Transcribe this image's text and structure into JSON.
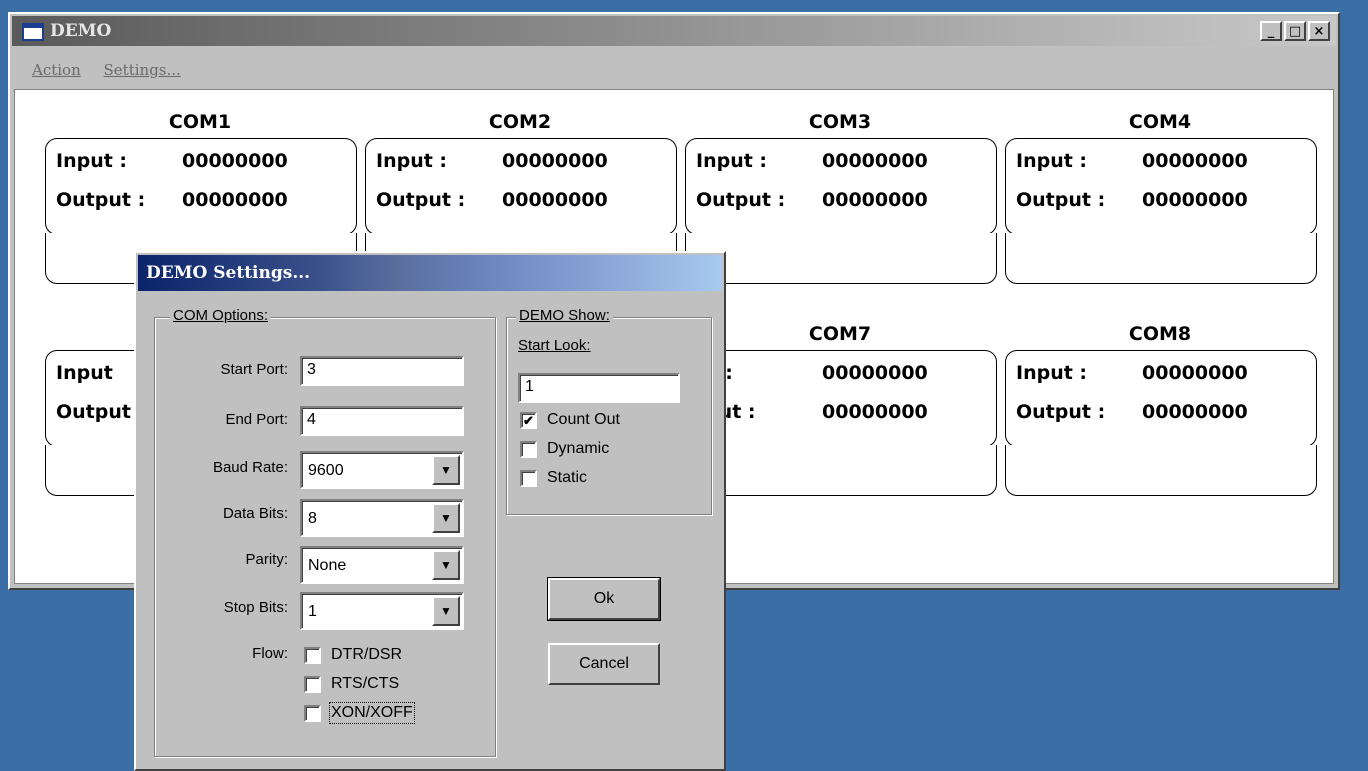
{
  "window": {
    "title": "DEMO",
    "minimize": "_",
    "maximize": "□",
    "close": "×"
  },
  "menu": {
    "action": "Action",
    "settings": "Settings..."
  },
  "com_panels": [
    {
      "title": "COM1",
      "input_label": "Input  :",
      "input_value": "00000000",
      "output_label": "Output :",
      "output_value": "00000000"
    },
    {
      "title": "COM2",
      "input_label": "Input  :",
      "input_value": "00000000",
      "output_label": "Output :",
      "output_value": "00000000"
    },
    {
      "title": "COM3",
      "input_label": "Input  :",
      "input_value": "00000000",
      "output_label": "Output :",
      "output_value": "00000000"
    },
    {
      "title": "COM4",
      "input_label": "Input  :",
      "input_value": "00000000",
      "output_label": "Output :",
      "output_value": "00000000"
    },
    {
      "title": "",
      "input_label": "Input",
      "input_value": "",
      "output_label": "Output",
      "output_value": ""
    },
    {
      "title": "",
      "input_label": "",
      "input_value": "",
      "output_label": "",
      "output_value": ""
    },
    {
      "title": "COM7",
      "input_label": "ut  :",
      "input_value": "00000000",
      "output_label": "tput :",
      "output_value": "00000000"
    },
    {
      "title": "COM8",
      "input_label": "Input  :",
      "input_value": "00000000",
      "output_label": "Output :",
      "output_value": "00000000"
    }
  ],
  "dialog": {
    "title": "DEMO Settings...",
    "com_options": {
      "label": "COM Options:",
      "start_port_label": "Start Port:",
      "start_port_value": "3",
      "end_port_label": "End Port:",
      "end_port_value": "4",
      "baud_rate_label": "Baud Rate:",
      "baud_rate_value": "9600",
      "data_bits_label": "Data Bits:",
      "data_bits_value": "8",
      "parity_label": "Parity:",
      "parity_value": "None",
      "stop_bits_label": "Stop Bits:",
      "stop_bits_value": "1",
      "flow_label": "Flow:",
      "flow_options": [
        {
          "label": "DTR/DSR",
          "checked": false
        },
        {
          "label": "RTS/CTS",
          "checked": false
        },
        {
          "label": "XON/XOFF",
          "checked": false
        }
      ]
    },
    "demo_show": {
      "label": "DEMO Show:",
      "start_look_label": "Start Look:",
      "start_look_value": "1",
      "options": [
        {
          "label": "Count Out",
          "checked": true
        },
        {
          "label": "Dynamic",
          "checked": false
        },
        {
          "label": "Static",
          "checked": false
        }
      ]
    },
    "ok_label": "Ok",
    "cancel_label": "Cancel",
    "check_mark": "✔",
    "dropdown_arrow": "▼"
  },
  "colors": {
    "desktop": "#3a6ea5",
    "face": "#c0c0c0",
    "dialog_title_start": "#0a246a",
    "dialog_title_end": "#a6caf0"
  }
}
